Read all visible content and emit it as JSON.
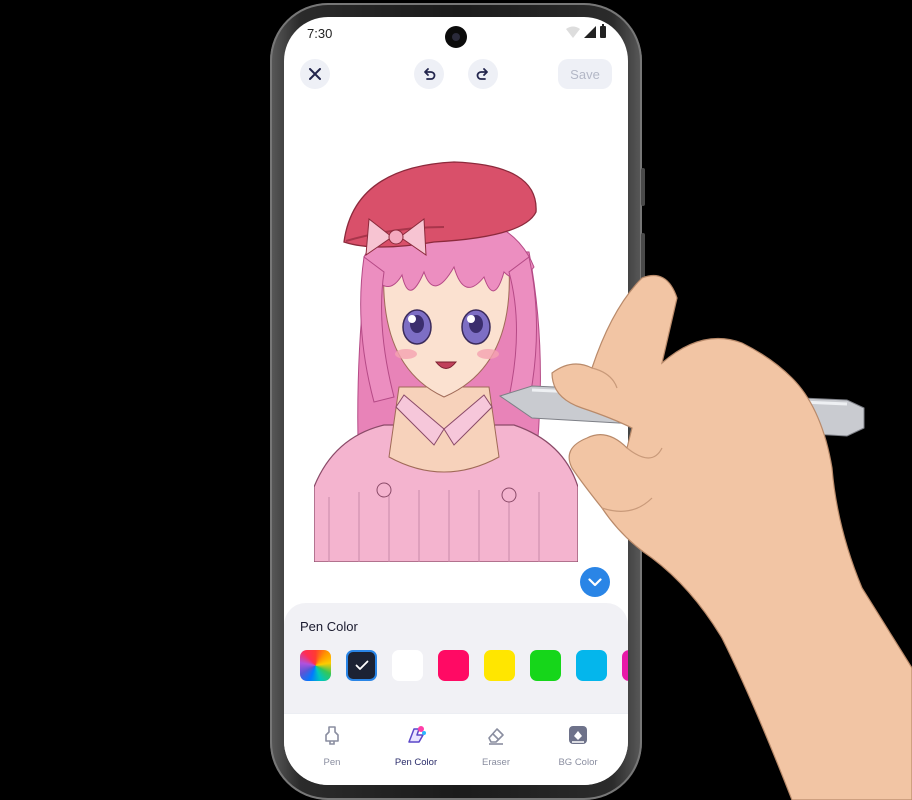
{
  "status": {
    "time": "7:30"
  },
  "topbar": {
    "close_icon": "close-icon",
    "undo_icon": "undo-icon",
    "redo_icon": "redo-icon",
    "save_label": "Save"
  },
  "panel": {
    "title": "Pen Color",
    "swatches": [
      {
        "name": "rainbow",
        "color": "multicolor"
      },
      {
        "name": "black",
        "color": "#1c2233",
        "selected": true
      },
      {
        "name": "white",
        "color": "#ffffff"
      },
      {
        "name": "pink",
        "color": "#ff0a64"
      },
      {
        "name": "yellow",
        "color": "#ffe600"
      },
      {
        "name": "green",
        "color": "#16d61a"
      },
      {
        "name": "cyan",
        "color": "#04b6ec"
      },
      {
        "name": "magenta",
        "color": "#e81aa8"
      }
    ]
  },
  "tabs": [
    {
      "label": "Pen",
      "icon": "pen-icon"
    },
    {
      "label": "Pen Color",
      "icon": "pen-color-icon",
      "active": true
    },
    {
      "label": "Eraser",
      "icon": "eraser-icon"
    },
    {
      "label": "BG Color",
      "icon": "bg-color-icon"
    }
  ],
  "colors": {
    "accent": "#2a85e6",
    "panel_bg": "#f1f1f5"
  }
}
